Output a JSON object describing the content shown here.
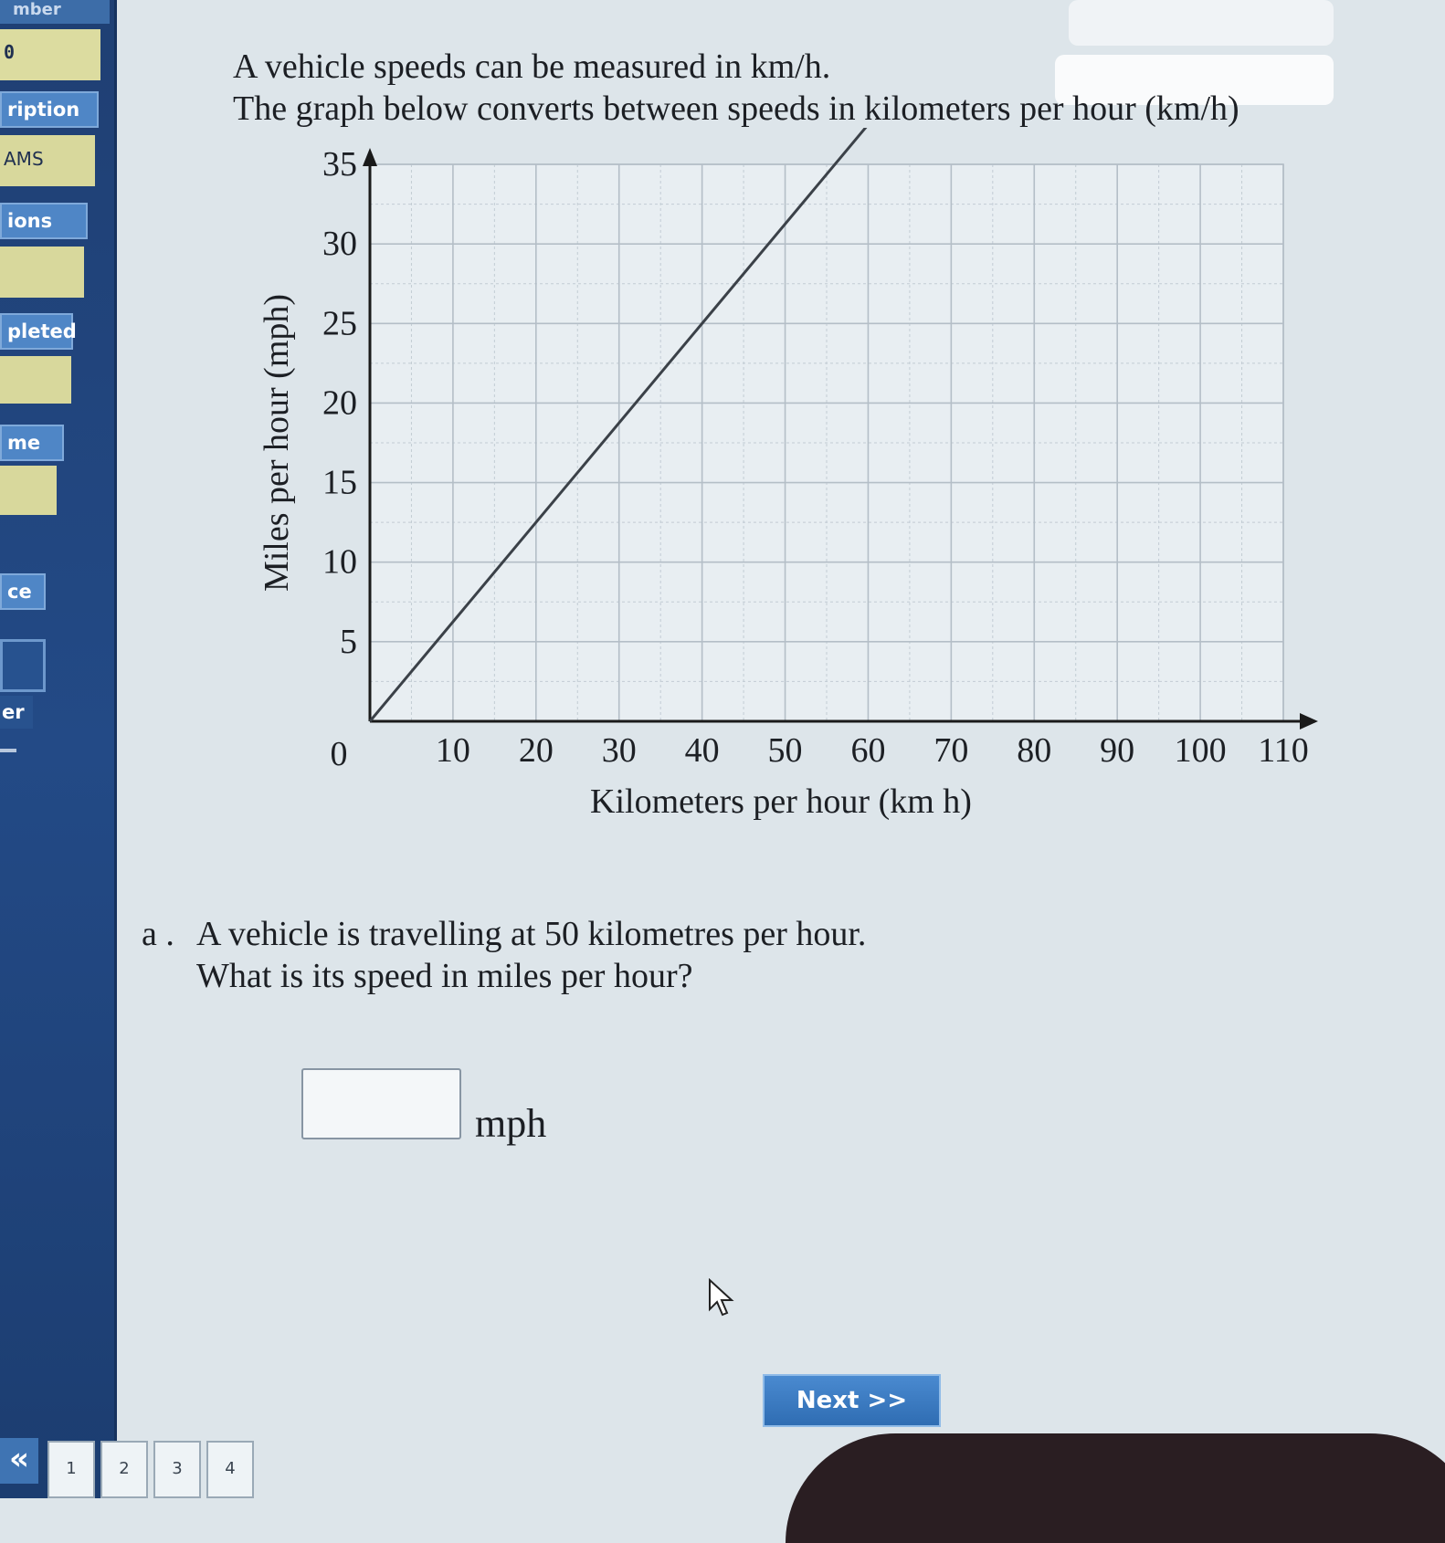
{
  "sidebar": {
    "header": "mber",
    "value": "0",
    "labels": [
      "ription",
      "AMS",
      "ions",
      "pleted",
      "me",
      "ce",
      "er"
    ]
  },
  "problem": {
    "line1": "A vehicle speeds can be measured in km/h.",
    "line2": "The graph below converts between speeds in kilometers per hour (km/h)",
    "question_prefix": "a .",
    "question_line1": "A vehicle is travelling at 50 kilometres per hour.",
    "question_line2": "What is its speed in miles per hour?",
    "answer_value": "",
    "answer_unit": "mph"
  },
  "chart_data": {
    "type": "line",
    "xlabel": "Kilometers per hour (km h)",
    "ylabel": "Miles per hour (mph)",
    "xlim": [
      0,
      110
    ],
    "ylim": [
      0,
      35
    ],
    "x_ticks": [
      10,
      20,
      30,
      40,
      50,
      60,
      70,
      80,
      90,
      100,
      110
    ],
    "y_ticks": [
      5,
      10,
      15,
      20,
      25,
      30,
      35
    ],
    "origin_label": "0",
    "grid": true,
    "series": [
      {
        "x": [
          0,
          60
        ],
        "y": [
          0,
          37.5
        ]
      }
    ]
  },
  "navigation": {
    "next_label": "Next >>",
    "prev_label": "«",
    "pages": [
      "1",
      "2",
      "3",
      "4"
    ]
  }
}
